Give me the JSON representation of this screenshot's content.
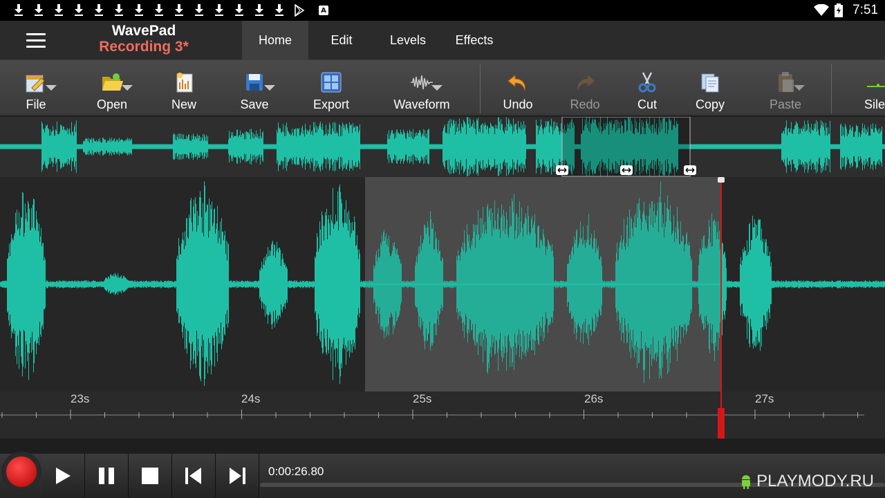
{
  "status_bar": {
    "download_count": 14,
    "icons": [
      "download-icon",
      "play-store-icon",
      "a-badge-icon",
      "wifi-icon",
      "battery-icon"
    ],
    "a_badge": "A",
    "time": "7:51"
  },
  "app": {
    "name": "WavePad",
    "file": "Recording 3*"
  },
  "tabs": [
    {
      "label": "Home",
      "active": true
    },
    {
      "label": "Edit",
      "active": false
    },
    {
      "label": "Levels",
      "active": false
    },
    {
      "label": "Effects",
      "active": false
    }
  ],
  "toolbar": {
    "file": "File",
    "open": "Open",
    "new": "New",
    "save": "Save",
    "export": "Export",
    "waveform": "Waveform",
    "undo": "Undo",
    "redo": "Redo",
    "cut": "Cut",
    "copy": "Copy",
    "paste": "Paste",
    "silence": "Silen"
  },
  "timeline": {
    "ticks": [
      "23s",
      "24s",
      "25s",
      "26s",
      "27s"
    ]
  },
  "transport": {
    "position": "0:00:26.80"
  },
  "watermark": "PLAYMODY.RU",
  "colors": {
    "waveform": "#1fbfa5",
    "accent_title": "#f06c5e",
    "cursor": "#d41818",
    "record": "#e02020"
  }
}
